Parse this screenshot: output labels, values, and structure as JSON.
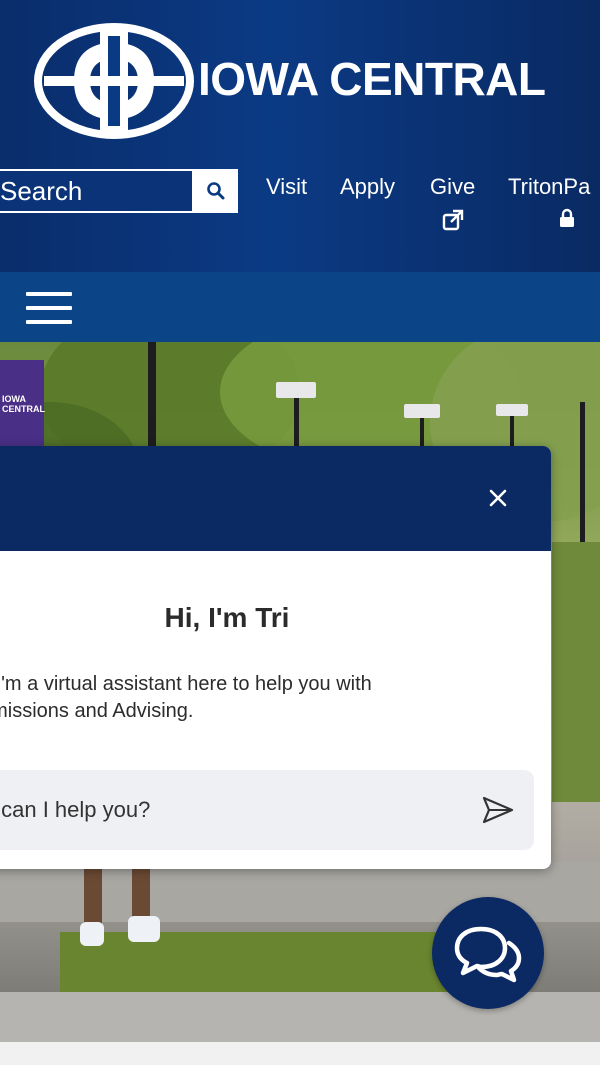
{
  "brand": {
    "name": "IOWA CENTRAL",
    "colors": {
      "header": "#0b3a84",
      "navbar": "#0b4588",
      "chat": "#0b2a64"
    }
  },
  "search": {
    "placeholder": "Search",
    "button_icon": "search-icon"
  },
  "top_links": [
    {
      "label": "Visit"
    },
    {
      "label": "Apply"
    },
    {
      "label": "Give",
      "icon": "external-link-icon"
    },
    {
      "label": "TritonPa",
      "icon": "lock-icon"
    }
  ],
  "nav": {
    "menu_icon": "hamburger-menu-icon"
  },
  "hero": {
    "banner_text": "IOWA CENTRAL"
  },
  "chat": {
    "close_icon": "close-icon",
    "title": "Hi, I'm Tri",
    "message_line1": "i, I'm a virtual assistant here to help you with",
    "message_line2": "dmissions and Advising.",
    "input_placeholder": "v can I help you?",
    "send_icon": "send-icon",
    "launcher_icon": "chat-bubbles-icon"
  }
}
